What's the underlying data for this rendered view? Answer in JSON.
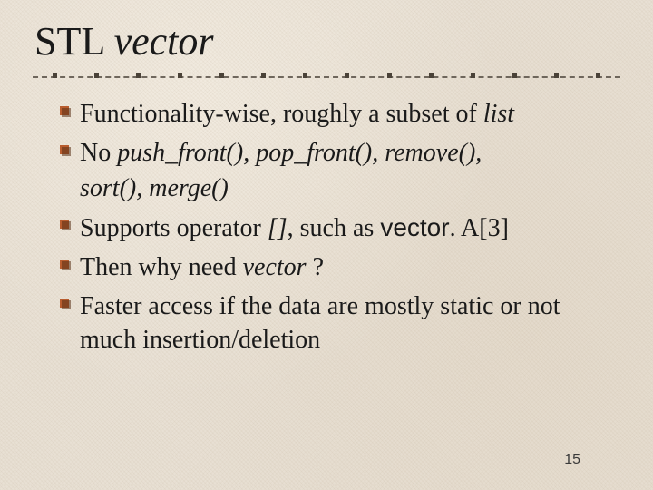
{
  "title": {
    "plain": "STL ",
    "italic": "vector"
  },
  "bullets": [
    {
      "pre": "Functionality-wise, roughly a subset of ",
      "it1": "list",
      "post": ""
    },
    {
      "pre": "No ",
      "it1": "push_front(), pop_front(), remove(), ",
      "cont_it": "sort(), merge()"
    },
    {
      "pre": "Supports operator ",
      "it1": "[]",
      "mid": ", such as ",
      "sans": "vector",
      "post2": ". A[3]"
    },
    {
      "pre": "Then why need ",
      "it1": "vector ",
      "post": "?"
    },
    {
      "pre": "Faster access if the data are mostly static or not much insertion/deletion"
    }
  ],
  "page_number": "15",
  "colors": {
    "bullet_fill": "#b85c2e",
    "bullet_dark": "#5a3118"
  }
}
